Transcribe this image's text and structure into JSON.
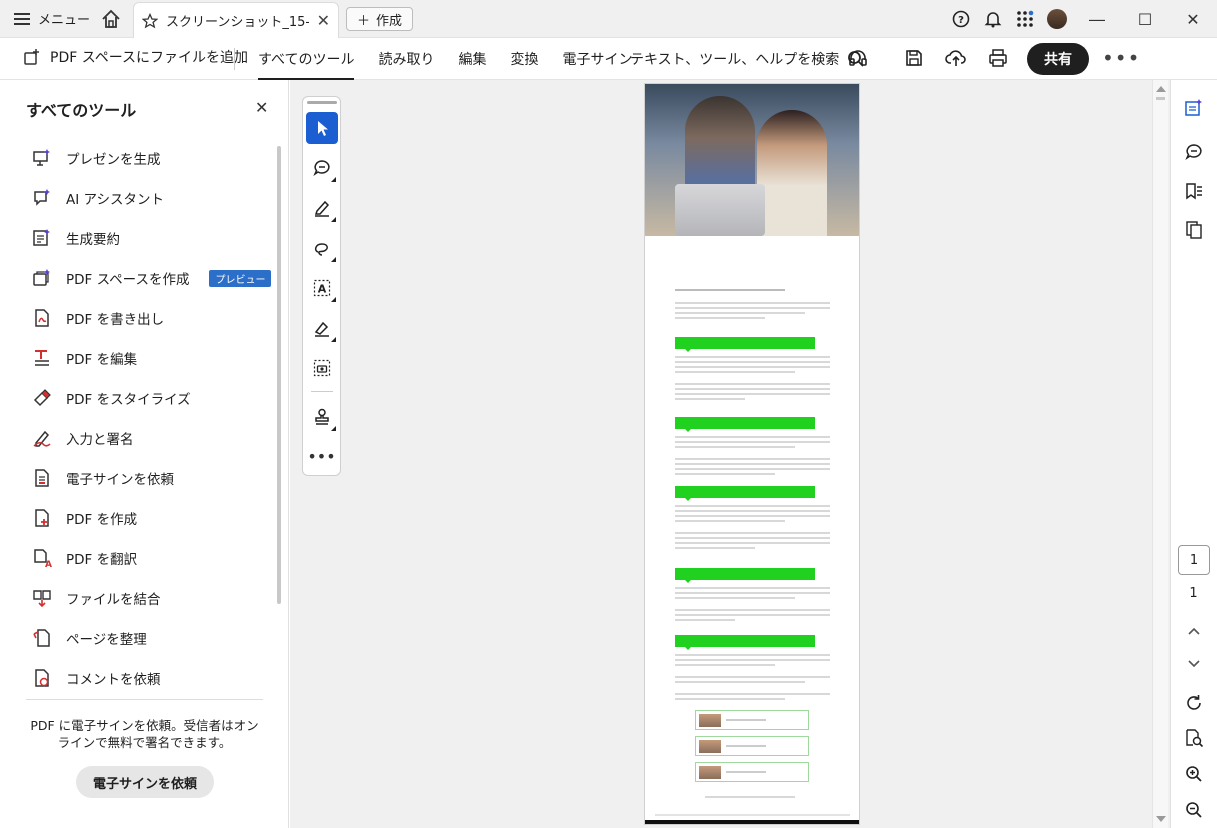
{
  "titlebar": {
    "menu_label": "メニュー",
    "tab_title": "スクリーンショット_15-7-...",
    "new_button": "作成"
  },
  "toolbar": {
    "add_to_space": "PDF スペースにファイルを追加",
    "tabs": [
      "すべてのツール",
      "読み取り",
      "編集",
      "変換",
      "電子サイン"
    ],
    "search": "テキスト、ツール、ヘルプを検索",
    "share": "共有"
  },
  "left_panel": {
    "title": "すべてのツール",
    "items": [
      {
        "label": "プレゼンを生成",
        "icon": "presentation-ai-icon"
      },
      {
        "label": "AI アシスタント",
        "icon": "ai-assistant-icon"
      },
      {
        "label": "生成要約",
        "icon": "summary-icon"
      },
      {
        "label": "PDF スペースを作成",
        "icon": "pdf-space-icon",
        "badge": "プレビュー"
      },
      {
        "label": "PDF を書き出し",
        "icon": "export-pdf-icon"
      },
      {
        "label": "PDF を編集",
        "icon": "edit-pdf-icon"
      },
      {
        "label": "PDF をスタイライズ",
        "icon": "stylize-icon"
      },
      {
        "label": "入力と署名",
        "icon": "fill-sign-icon"
      },
      {
        "label": "電子サインを依頼",
        "icon": "request-signature-icon"
      },
      {
        "label": "PDF を作成",
        "icon": "create-pdf-icon"
      },
      {
        "label": "PDF を翻訳",
        "icon": "translate-icon"
      },
      {
        "label": "ファイルを結合",
        "icon": "combine-icon"
      },
      {
        "label": "ページを整理",
        "icon": "organize-pages-icon"
      },
      {
        "label": "コメントを依頼",
        "icon": "request-comments-icon"
      }
    ],
    "promo_text": "PDF に電子サインを依頼。受信者はオンラインで無料で署名できます。",
    "promo_button": "電子サインを依頼"
  },
  "page_nav": {
    "current": "1",
    "total": "1"
  },
  "colors": {
    "accent": "#1a5ed1",
    "badge": "#2c6fc9",
    "share_bg": "#1f1f1f",
    "page_heading_green": "#21d11f"
  }
}
